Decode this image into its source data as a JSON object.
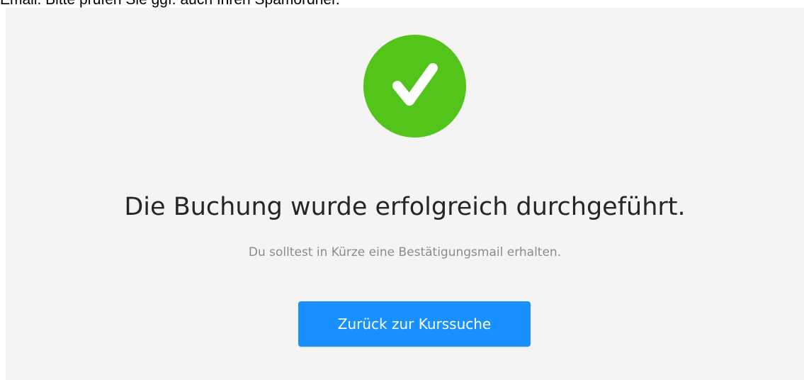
{
  "page": {
    "top_note": "Email. Bitte prüfen Sie ggf. auch Ihren Spamordner."
  },
  "result": {
    "status": "success",
    "icon": "check-circle-icon",
    "title": "Die Buchung wurde erfolgreich durchgeführt.",
    "subtitle": "Du solltest in Kürze eine Bestätigungsmail erhalten.",
    "button_label": "Zurück zur Kurssuche"
  },
  "colors": {
    "success": "#52c41a",
    "primary": "#1890ff",
    "panel_bg": "#f4f4f4",
    "title_text": "#262626",
    "subtitle_text": "#8c8c8c"
  }
}
